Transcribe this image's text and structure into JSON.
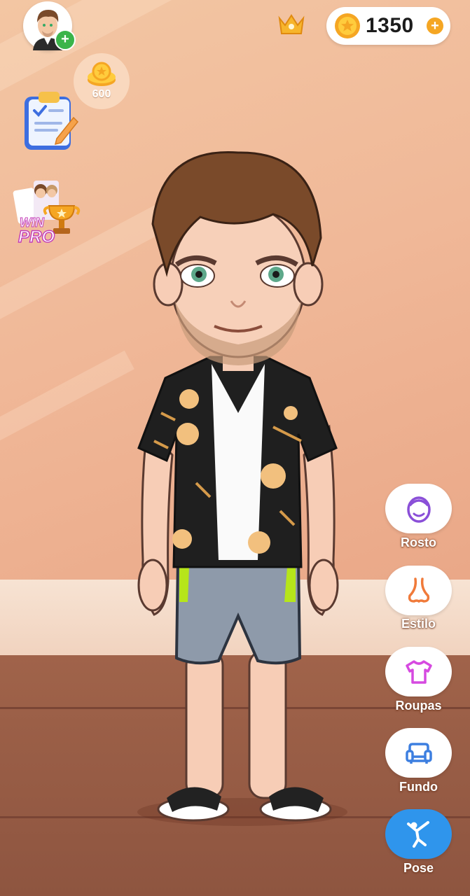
{
  "header": {
    "coins": "1350",
    "coin_add_symbol": "+",
    "profile_add_symbol": "+"
  },
  "reward": {
    "amount": "600"
  },
  "contest": {
    "label_top": "WIN",
    "label_bottom": "PRO"
  },
  "menu": {
    "face_label": "Rosto",
    "style_label": "Estilo",
    "clothes_label": "Roupas",
    "background_label": "Fundo",
    "pose_label": "Pose"
  },
  "colors": {
    "accent_blue": "#2f95ec",
    "coin_gold": "#f5a623",
    "plus_green": "#3bb44a",
    "face_icon": "#8a4fd8",
    "style_icon": "#f07a3a",
    "clothes_icon": "#d64ae0",
    "background_icon": "#3d7fe0"
  }
}
